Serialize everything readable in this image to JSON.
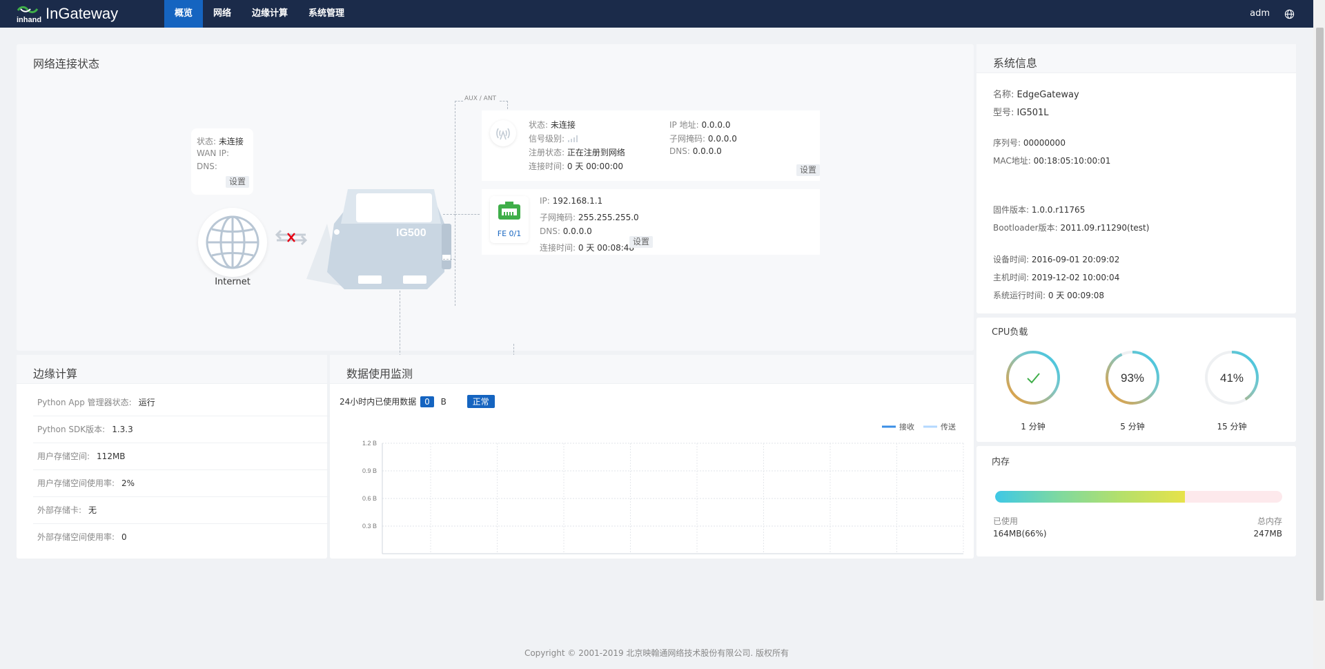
{
  "header": {
    "logo_inhand": "inhand",
    "logo_product": "InGateway",
    "nav": [
      "概览",
      "网络",
      "边缘计算",
      "系统管理"
    ],
    "user": "adm"
  },
  "network": {
    "title": "网络连接状态",
    "wan": {
      "status_label": "状态:",
      "status_value": "未连接",
      "ip_label": "WAN IP:",
      "ip_value": "",
      "dns_label": "DNS:",
      "dns_value": "",
      "set": "设置"
    },
    "internet_label": "Internet",
    "device_model": "IG500",
    "aux_label": "AUX / ANT",
    "cellular": {
      "status_label": "状态:",
      "status_value": "未连接",
      "signal_label": "信号级别:",
      "reg_label": "注册状态:",
      "reg_value": "正在注册到网络",
      "conn_label": "连接时间:",
      "conn_value": "0 天 00:00:00",
      "ip_label": "IP 地址:",
      "ip_value": "0.0.0.0",
      "mask_label": "子网掩码:",
      "mask_value": "0.0.0.0",
      "dns_label": "DNS:",
      "dns_value": "0.0.0.0",
      "set": "设置"
    },
    "lan": {
      "port": "FE 0/1",
      "ip_label": "IP:",
      "ip_value": "192.168.1.1",
      "mask_label": "子网掩码:",
      "mask_value": "255.255.255.0",
      "dns_label": "DNS:",
      "dns_value": "0.0.0.0",
      "conn_label": "连接时间:",
      "conn_value": "0 天 00:08:48",
      "set": "设置"
    }
  },
  "sysinfo": {
    "title": "系统信息",
    "name_label": "名称:",
    "name_value": "EdgeGateway",
    "model_label": "型号:",
    "model_value": "IG501L",
    "serial_label": "序列号:",
    "serial_value": "00000000",
    "mac_label": "MAC地址:",
    "mac_value": "00:18:05:10:00:01",
    "fw_label": "固件版本:",
    "fw_value": "1.0.0.r11765",
    "boot_label": "Bootloader版本:",
    "boot_value": "2011.09.r11290(test)",
    "devtime_label": "设备时间:",
    "devtime_value": "2016-09-01 20:09:02",
    "hosttime_label": "主机时间:",
    "hosttime_value": "2019-12-02 10:00:04",
    "uptime_label": "系统运行时间:",
    "uptime_value": "0 天 00:09:08"
  },
  "cpu": {
    "title": "CPU负载",
    "gauges": [
      {
        "label": "1 分钟",
        "text": "",
        "check": true,
        "percent": 100
      },
      {
        "label": "5 分钟",
        "text": "93%",
        "check": false,
        "percent": 93
      },
      {
        "label": "15 分钟",
        "text": "41%",
        "check": false,
        "percent": 41
      }
    ]
  },
  "memory": {
    "title": "内存",
    "used_label": "已使用",
    "used_value": "164MB(66%)",
    "total_label": "总内存",
    "total_value": "247MB",
    "used_fraction": 0.66
  },
  "edge": {
    "title": "边缘计算",
    "rows": [
      {
        "label": "Python App 管理器状态:",
        "value": "运行"
      },
      {
        "label": "Python SDK版本:",
        "value": "1.3.3"
      },
      {
        "label": "用户存储空间:",
        "value": "112MB"
      },
      {
        "label": "用户存储空间使用率:",
        "value": "2%"
      },
      {
        "label": "外部存储卡:",
        "value": "无"
      },
      {
        "label": "外部存储空间使用率:",
        "value": "0"
      }
    ]
  },
  "data_usage": {
    "title": "数据使用监测",
    "used_label": "24小时内已使用数据",
    "used_value": "0",
    "unit": "B",
    "status": "正常"
  },
  "chart_data": {
    "type": "line",
    "series": [
      {
        "name": "接收",
        "values": [],
        "color": "#3a8ee6"
      },
      {
        "name": "传送",
        "values": [],
        "color": "#b3d8ff"
      }
    ],
    "y_ticks": [
      "1.2 B",
      "0.9 B",
      "0.6 B",
      "0.3 B"
    ],
    "ylim": [
      0,
      1.2
    ],
    "legend": "top-right",
    "grid": true
  },
  "footer": {
    "text": "Copyright © 2001-2019 北京映翰通网络技术股份有限公司. 版权所有"
  }
}
